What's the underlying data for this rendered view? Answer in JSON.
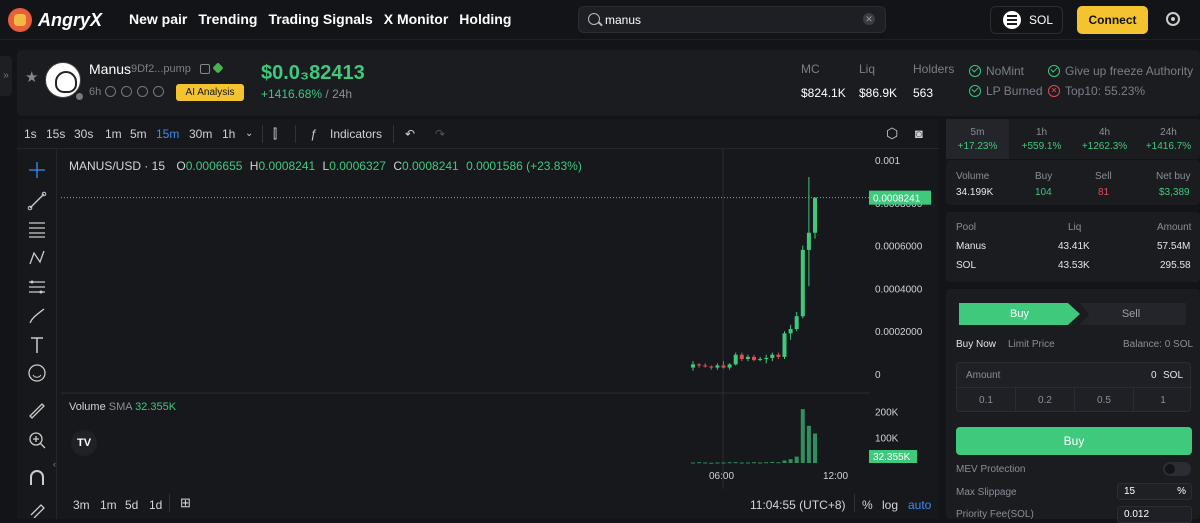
{
  "nav": {
    "brand": "AngryX",
    "links": [
      "New pair",
      "Trending",
      "Trading Signals",
      "X Monitor",
      "Holding"
    ],
    "search_value": "manus",
    "chain": "SOL",
    "connect": "Connect"
  },
  "token": {
    "name": "Manus",
    "address": "9Df2...pump",
    "age": "6h",
    "ai_button": "AI Analysis",
    "price": "$0.0₃82413",
    "change": "+1416.68%",
    "change_tf": "/ 24h"
  },
  "stats": [
    {
      "label": "MC",
      "value": "$824.1K"
    },
    {
      "label": "Liq",
      "value": "$86.9K"
    },
    {
      "label": "Holders",
      "value": "563"
    }
  ],
  "checks": [
    {
      "label": "NoMint",
      "ok": true
    },
    {
      "label": "Give up freeze Authority",
      "ok": true
    },
    {
      "label": "LP Burned",
      "ok": true
    },
    {
      "label": "Top10: 55.23%",
      "ok": false
    }
  ],
  "toolbar": {
    "timeframes": [
      "1s",
      "15s",
      "30s",
      "1m",
      "5m",
      "15m",
      "30m",
      "1h"
    ],
    "active": "15m",
    "indicators": "Indicators"
  },
  "chart": {
    "symbol": "MANUS/USD · 15",
    "o_label": "O",
    "o": "0.0006655",
    "h_label": "H",
    "h": "0.0008241",
    "l_label": "L",
    "l": "0.0006327",
    "c_label": "C",
    "c": "0.0008241",
    "delta": "0.0001586 (+23.83%)",
    "vol_label": "Volume",
    "sma_label": "SMA",
    "sma": "32.355K",
    "last_price": "0.0008241",
    "vol_tag": "32.355K"
  },
  "bottom": {
    "ranges": [
      "3m",
      "1m",
      "5d",
      "1d"
    ],
    "time": "11:04:55 (UTC+8)",
    "pct": "%",
    "log": "log",
    "auto": "auto"
  },
  "chart_data": [
    {
      "type": "candlestick",
      "title": "MANUS/USD · 15",
      "y_ticks": [
        "0.001",
        "0.0008000",
        "0.0006000",
        "0.0004000",
        "0.0002000",
        "0"
      ],
      "x_ticks": [
        "06:00",
        "12:00"
      ],
      "ylim": [
        0,
        0.001
      ],
      "candles": [
        {
          "o": 3e-05,
          "h": 6e-05,
          "l": 1.5e-05,
          "c": 4.5e-05
        },
        {
          "o": 4.5e-05,
          "h": 5e-05,
          "l": 3e-05,
          "c": 4e-05
        },
        {
          "o": 4e-05,
          "h": 5e-05,
          "l": 3e-05,
          "c": 3.5e-05
        },
        {
          "o": 3.5e-05,
          "h": 4e-05,
          "l": 2e-05,
          "c": 3e-05
        },
        {
          "o": 3e-05,
          "h": 5e-05,
          "l": 2e-05,
          "c": 4e-05
        },
        {
          "o": 4e-05,
          "h": 6e-05,
          "l": 2.5e-05,
          "c": 3e-05
        },
        {
          "o": 3e-05,
          "h": 5e-05,
          "l": 2e-05,
          "c": 4.5e-05
        },
        {
          "o": 4.5e-05,
          "h": 0.0001,
          "l": 4e-05,
          "c": 9e-05
        },
        {
          "o": 9e-05,
          "h": 0.0001,
          "l": 6e-05,
          "c": 7e-05
        },
        {
          "o": 7e-05,
          "h": 9e-05,
          "l": 6e-05,
          "c": 8e-05
        },
        {
          "o": 8e-05,
          "h": 9e-05,
          "l": 6e-05,
          "c": 6.5e-05
        },
        {
          "o": 6.5e-05,
          "h": 8e-05,
          "l": 6e-05,
          "c": 7e-05
        },
        {
          "o": 7e-05,
          "h": 9e-05,
          "l": 5e-05,
          "c": 7.5e-05
        },
        {
          "o": 7.5e-05,
          "h": 0.0001,
          "l": 6e-05,
          "c": 9e-05
        },
        {
          "o": 9e-05,
          "h": 0.0001,
          "l": 7e-05,
          "c": 8e-05
        },
        {
          "o": 8e-05,
          "h": 0.0002,
          "l": 7e-05,
          "c": 0.00019
        },
        {
          "o": 0.00019,
          "h": 0.00023,
          "l": 0.00016,
          "c": 0.00021
        },
        {
          "o": 0.00021,
          "h": 0.00029,
          "l": 0.0002,
          "c": 0.00027
        },
        {
          "o": 0.00027,
          "h": 0.0006,
          "l": 0.00026,
          "c": 0.00058
        },
        {
          "o": 0.00058,
          "h": 0.00092,
          "l": 0.00041,
          "c": 0.00066
        },
        {
          "o": 0.00066,
          "h": 0.0008241,
          "l": 0.0006327,
          "c": 0.0008241
        }
      ]
    },
    {
      "type": "bar",
      "title": "Volume",
      "y_ticks": [
        "200K",
        "100K"
      ],
      "values": [
        2,
        3,
        2,
        1,
        2,
        2,
        3,
        3,
        2,
        2,
        3,
        2,
        3,
        4,
        3,
        10,
        15,
        25,
        210,
        145,
        115
      ]
    }
  ],
  "right": {
    "tabs": [
      {
        "tf": "5m",
        "pct": "+17.23%"
      },
      {
        "tf": "1h",
        "pct": "+559.1%"
      },
      {
        "tf": "4h",
        "pct": "+1262.3%"
      },
      {
        "tf": "24h",
        "pct": "+1416.7%"
      }
    ],
    "vol_row": {
      "volume_label": "Volume",
      "volume": "34.199K",
      "buy_label": "Buy",
      "buy": "104",
      "sell_label": "Sell",
      "sell": "81",
      "net_label": "Net buy",
      "net": "$3,389"
    },
    "pool": {
      "headers": [
        "Pool",
        "Liq",
        "Amount"
      ],
      "rows": [
        [
          "Manus",
          "43.41K",
          "57.54M"
        ],
        [
          "SOL",
          "43.53K",
          "295.58"
        ]
      ]
    },
    "trade": {
      "buy_tab": "Buy",
      "sell_tab": "Sell",
      "buy_now": "Buy Now",
      "limit": "Limit Price",
      "balance": "Balance: 0 SOL",
      "amount_label": "Amount",
      "amount_value": "0",
      "amount_unit": "SOL",
      "presets": [
        "0.1",
        "0.2",
        "0.5",
        "1"
      ],
      "buy_button": "Buy",
      "mev": "MEV Protection",
      "slippage_label": "Max Slippage",
      "slippage": "15",
      "slippage_unit": "%",
      "priority_label": "Priority Fee(SOL)",
      "priority": "0.012"
    }
  },
  "colors": {
    "green": "#3ec97d",
    "red": "#e04b5a",
    "accent": "#f4c430"
  }
}
